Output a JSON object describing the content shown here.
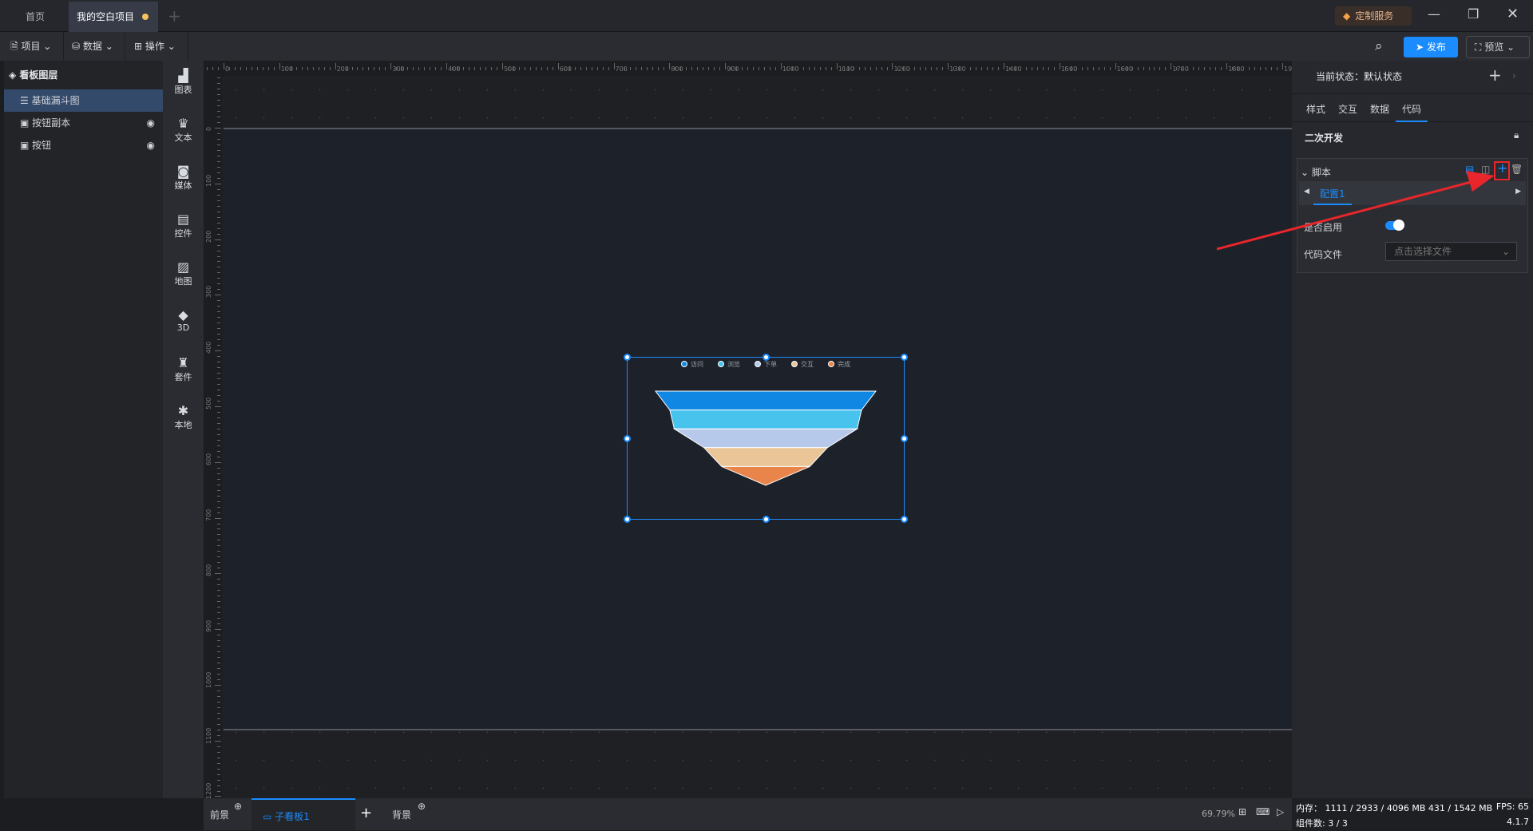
{
  "titlebar": {
    "tabs": [
      {
        "label": "首页"
      },
      {
        "label": "我的空白项目"
      }
    ],
    "custom_service": "定制服务"
  },
  "toolbar": {
    "project": "项目",
    "data": "数据",
    "operate": "操作",
    "publish": "发布",
    "preview": "预览"
  },
  "layers": {
    "title": "看板图层",
    "items": [
      {
        "label": "基础漏斗图",
        "selected": true
      },
      {
        "label": "按钮副本"
      },
      {
        "label": "按钮"
      }
    ]
  },
  "components": [
    {
      "label": "图表",
      "icon": "bar-chart-icon"
    },
    {
      "label": "文本",
      "icon": "crown-icon"
    },
    {
      "label": "媒体",
      "icon": "bag-icon"
    },
    {
      "label": "控件",
      "icon": "list-icon"
    },
    {
      "label": "地图",
      "icon": "map-icon"
    },
    {
      "label": "3D",
      "icon": "cube-icon"
    },
    {
      "label": "套件",
      "icon": "shirt-icon"
    },
    {
      "label": "本地",
      "icon": "puzzle-icon"
    }
  ],
  "right_panel": {
    "state_label": "当前状态：默认状态",
    "tabs": [
      "样式",
      "交互",
      "数据",
      "代码"
    ],
    "active_tab": "代码",
    "section": "二次开发",
    "script": {
      "title": "脚本",
      "config_tab": "配置1",
      "enable_label": "是否启用",
      "enabled": true,
      "file_label": "代码文件",
      "file_placeholder": "点击选择文件"
    }
  },
  "bottom": {
    "foreground": "前景",
    "sub_board": "子看板1",
    "background": "背景",
    "zoom": "69.79%"
  },
  "status": {
    "memory": "内存： 1111 / 2933 / 4096 MB  431 / 1542 MB",
    "fps": "FPS:  65",
    "components": "组件数: 3 / 3",
    "version": "4.1.7"
  },
  "chart_data": {
    "type": "funnel",
    "categories": [
      "访问",
      "浏览",
      "下单",
      "交互",
      "完成"
    ],
    "values": [
      100,
      87,
      83,
      56,
      40
    ],
    "colors": [
      "#1087e3",
      "#48c3ee",
      "#b6c9ea",
      "#eac597",
      "#e9844a"
    ],
    "legend": "top"
  },
  "colors": {
    "accent": "#1a8cff",
    "annotation": "#e8262b"
  }
}
